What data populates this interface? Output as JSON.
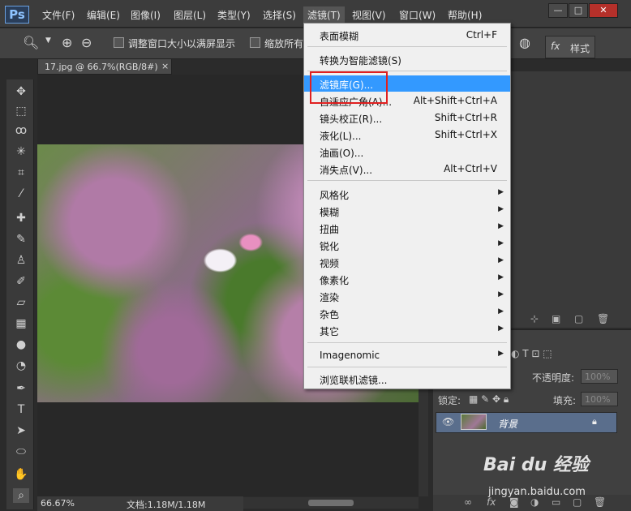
{
  "app": {
    "logo": "Ps"
  },
  "menubar": {
    "items": [
      "文件(F)",
      "编辑(E)",
      "图像(I)",
      "图层(L)",
      "类型(Y)",
      "选择(S)",
      "滤镜(T)",
      "视图(V)",
      "窗口(W)",
      "帮助(H)"
    ],
    "active": "滤镜(T)"
  },
  "optbar": {
    "resize_windows": "调整窗口大小以满屏显示",
    "zoom_all": "缩放所有"
  },
  "panel_style": {
    "label": "样式"
  },
  "document": {
    "tab_title": "17.jpg @ 66.7%(RGB/8#)",
    "zoom": "66.67%",
    "doc_size": "文档:1.18M/1.18M"
  },
  "filter_menu": {
    "items": [
      {
        "label": "表面模糊",
        "shortcut": "Ctrl+F"
      },
      {
        "label": "转换为智能滤镜(S)"
      },
      {
        "label": "滤镜库(G)...",
        "highlighted": true
      },
      {
        "label": "自适应广角(A)...",
        "shortcut": "Alt+Shift+Ctrl+A"
      },
      {
        "label": "镜头校正(R)...",
        "shortcut": "Shift+Ctrl+R"
      },
      {
        "label": "液化(L)...",
        "shortcut": "Shift+Ctrl+X"
      },
      {
        "label": "油画(O)..."
      },
      {
        "label": "消失点(V)...",
        "shortcut": "Alt+Ctrl+V"
      },
      {
        "label": "风格化",
        "submenu": true
      },
      {
        "label": "模糊",
        "submenu": true
      },
      {
        "label": "扭曲",
        "submenu": true
      },
      {
        "label": "锐化",
        "submenu": true
      },
      {
        "label": "视频",
        "submenu": true
      },
      {
        "label": "像素化",
        "submenu": true
      },
      {
        "label": "渲染",
        "submenu": true
      },
      {
        "label": "杂色",
        "submenu": true
      },
      {
        "label": "其它",
        "submenu": true
      },
      {
        "label": "Imagenomic",
        "submenu": true
      },
      {
        "label": "浏览联机滤镜..."
      }
    ],
    "highlight_color": "#3399ff"
  },
  "layers_panel": {
    "opacity_label": "不透明度:",
    "opacity_value": "100%",
    "lock_label": "锁定:",
    "fill_label": "填充:",
    "fill_value": "100%",
    "layer_name": "背景"
  },
  "watermark": {
    "logo": "Bai du 经验",
    "url": "jingyan.baidu.com"
  }
}
